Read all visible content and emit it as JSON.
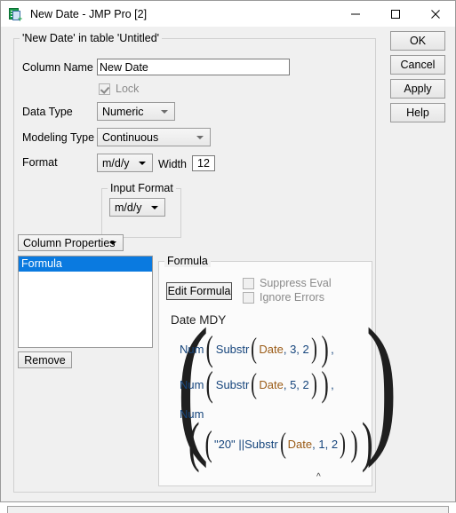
{
  "window": {
    "title": "New Date - JMP Pro [2]",
    "icon": "jmp-new-column-icon",
    "controls": {
      "minimize": "minimize-icon",
      "maximize": "maximize-icon",
      "close": "close-icon"
    }
  },
  "group": {
    "title": "'New Date' in table 'Untitled'"
  },
  "fields": {
    "column_name_label": "Column Name",
    "column_name_value": "New Date",
    "lock_label": "Lock",
    "lock_checked": true,
    "data_type_label": "Data Type",
    "data_type_value": "Numeric",
    "modeling_type_label": "Modeling Type",
    "modeling_type_value": "Continuous",
    "format_label": "Format",
    "format_value": "m/d/y",
    "width_label": "Width",
    "width_value": "12",
    "input_format_title": "Input Format",
    "input_format_value": "m/d/y"
  },
  "properties": {
    "menu_label": "Column Properties",
    "items": [
      {
        "label": "Formula",
        "selected": true
      }
    ],
    "remove_label": "Remove"
  },
  "formula_panel": {
    "title": "Formula",
    "edit_button": "Edit Formula",
    "suppress_eval_label": "Suppress Eval",
    "suppress_eval_checked": false,
    "ignore_errors_label": "Ignore Errors",
    "ignore_errors_checked": false,
    "expression_name": "Date MDY",
    "expression_rows": [
      {
        "fn_outer": "Num",
        "fn_inner": "Substr",
        "arg_col": "Date",
        "arg_start": "3",
        "arg_len": "2",
        "trailing": ","
      },
      {
        "fn_outer": "Num",
        "fn_inner": "Substr",
        "arg_col": "Date",
        "arg_start": "5",
        "arg_len": "2",
        "trailing": ","
      },
      {
        "fn_outer": "Num",
        "literal": "\"20\"",
        "concat": "||",
        "fn_inner": "Substr",
        "arg_col": "Date",
        "arg_start": "1",
        "arg_len": "2",
        "trailing": ""
      }
    ]
  },
  "buttons": {
    "ok": "OK",
    "cancel": "Cancel",
    "apply": "Apply",
    "help": "Help"
  },
  "colors": {
    "selection_blue": "#0a7ae0",
    "dialog_face": "#f0f0f0",
    "function_blue": "#16457c",
    "column_orange": "#9a5b16"
  }
}
